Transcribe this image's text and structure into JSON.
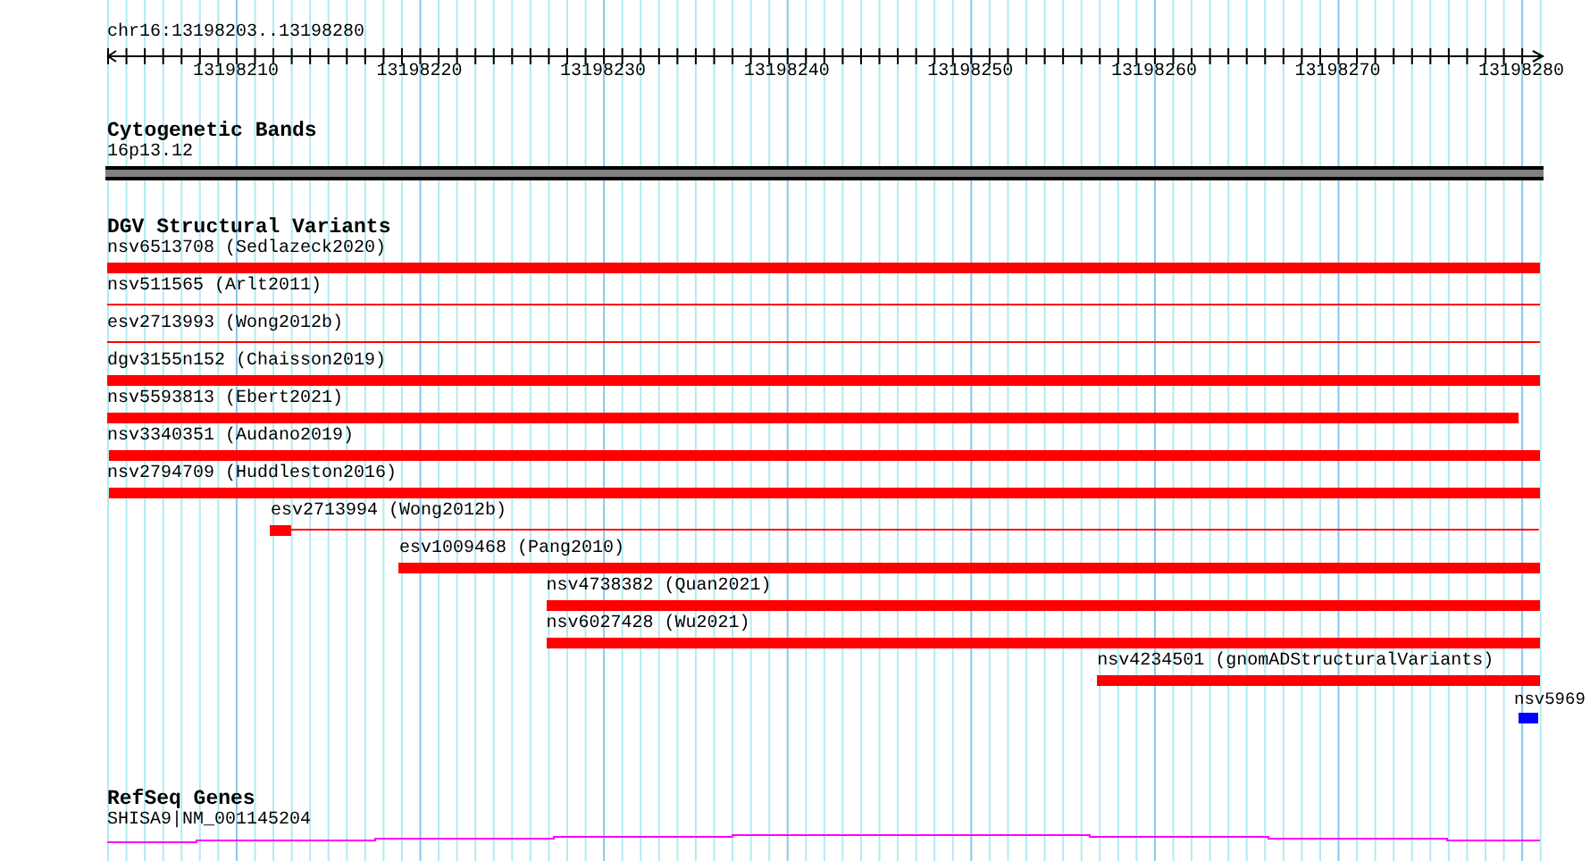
{
  "ruler": {
    "title": "chr16:13198203..13198280",
    "tick_labels": [
      "13198210",
      "13198220",
      "13198230",
      "13198240",
      "13198250",
      "13198260",
      "13198270",
      "13198280"
    ]
  },
  "tracks": [
    {
      "kind": "cytoband",
      "title": "Cytogenetic Bands",
      "features": [
        {
          "label": "16p13.12",
          "kind": "band",
          "color": "#808080"
        }
      ]
    },
    {
      "kind": "variants",
      "title": "DGV Structural Variants",
      "features": [
        {
          "label": "nsv6513708 (Sedlazeck2020)",
          "kind": "thick",
          "color": "#ff0000"
        },
        {
          "label": "nsv511565 (Arlt2011)",
          "kind": "thin",
          "color": "#ff0000"
        },
        {
          "label": "esv2713993 (Wong2012b)",
          "kind": "thin",
          "color": "#ff0000"
        },
        {
          "label": "dgv3155n152 (Chaisson2019)",
          "kind": "thick",
          "color": "#ff0000"
        },
        {
          "label": "nsv5593813 (Ebert2021)",
          "kind": "thick",
          "color": "#ff0000"
        },
        {
          "label": "nsv3340351 (Audano2019)",
          "kind": "thick",
          "color": "#ff0000"
        },
        {
          "label": "nsv2794709 (Huddleston2016)",
          "kind": "thick",
          "color": "#ff0000"
        },
        {
          "label": "esv2713994 (Wong2012b)",
          "kind": "partial",
          "color": "#ff0000"
        },
        {
          "label": "esv1009468 (Pang2010)",
          "kind": "thick",
          "color": "#ff0000"
        },
        {
          "label": "nsv4738382 (Quan2021)",
          "kind": "thick",
          "color": "#ff0000"
        },
        {
          "label": "nsv6027428 (Wu2021)",
          "kind": "thick",
          "color": "#ff0000"
        },
        {
          "label": "nsv4234501 (gnomADStructuralVariants)",
          "kind": "thick",
          "color": "#ff0000"
        },
        {
          "label": "nsv5969",
          "kind": "thick",
          "color": "#0000ff"
        }
      ]
    },
    {
      "kind": "gene",
      "title": "RefSeq Genes",
      "features": [
        {
          "label": "SHISA9|NM_001145204",
          "kind": "transcript",
          "color": "#ff00ff"
        }
      ]
    }
  ]
}
